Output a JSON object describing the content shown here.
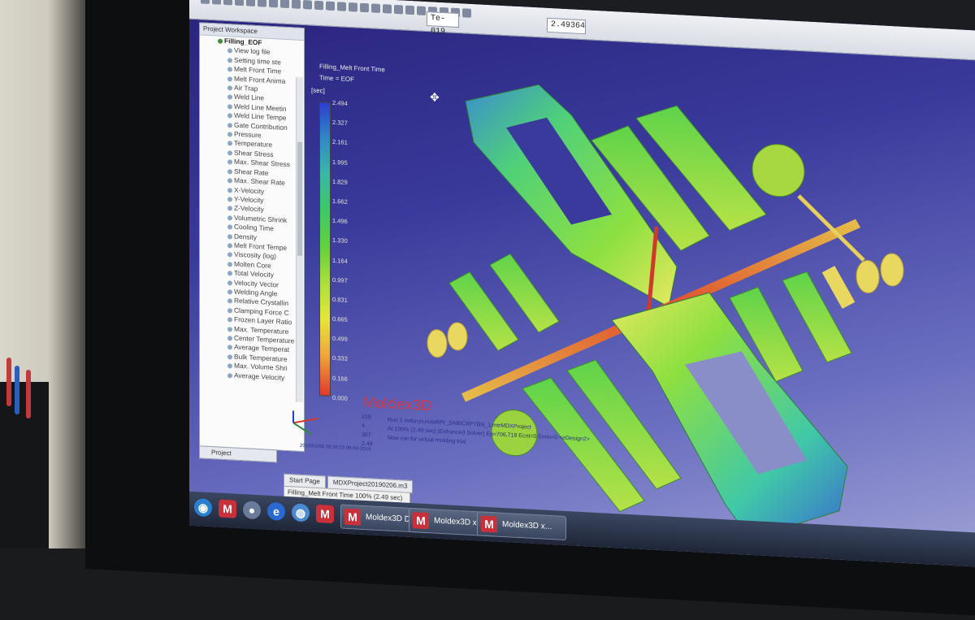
{
  "toolbar": {
    "field1": "Te-019",
    "field2": "2.49364"
  },
  "tree": {
    "header": "Project Workspace",
    "items": [
      {
        "label": "Filling_EOF",
        "root": true
      },
      {
        "label": "View log file"
      },
      {
        "label": "Setting time ste"
      },
      {
        "label": "Melt Front Time"
      },
      {
        "label": "Melt Front Anima"
      },
      {
        "label": "Air Trap"
      },
      {
        "label": "Weld Line"
      },
      {
        "label": "Weld Line Meetin"
      },
      {
        "label": "Weld Line Tempe"
      },
      {
        "label": "Gate Contribution"
      },
      {
        "label": "Pressure"
      },
      {
        "label": "Temperature"
      },
      {
        "label": "Shear Stress"
      },
      {
        "label": "Max. Shear Stress"
      },
      {
        "label": "Shear Rate"
      },
      {
        "label": "Max. Shear Rate"
      },
      {
        "label": "X-Velocity"
      },
      {
        "label": "Y-Velocity"
      },
      {
        "label": "Z-Velocity"
      },
      {
        "label": "Volumetric Shrink"
      },
      {
        "label": "Cooling Time"
      },
      {
        "label": "Density"
      },
      {
        "label": "Melt Front Tempe"
      },
      {
        "label": "Viscosity (log)"
      },
      {
        "label": "Molten Core"
      },
      {
        "label": "Total Velocity"
      },
      {
        "label": "Velocity Vector"
      },
      {
        "label": "Welding Angle"
      },
      {
        "label": "Relative Crystallin"
      },
      {
        "label": "Clamping Force C"
      },
      {
        "label": "Frozen Layer Ratio"
      },
      {
        "label": "Max. Temperature"
      },
      {
        "label": "Center Temperature"
      },
      {
        "label": "Average Temperat"
      },
      {
        "label": "Bulk Temperature"
      },
      {
        "label": "Max. Volume Shri"
      },
      {
        "label": "Average Velocity"
      }
    ],
    "project_tab": "Project"
  },
  "legend": {
    "title": "Filling_Melt Front Time",
    "time": "Time = EOF",
    "unit": "[sec]",
    "ticks": [
      "2.494",
      "2.327",
      "2.161",
      "1.995",
      "1.829",
      "1.662",
      "1.496",
      "1.330",
      "1.164",
      "0.997",
      "0.831",
      "0.665",
      "0.499",
      "0.333",
      "0.166",
      "0.000"
    ]
  },
  "logo": "Moldex3D",
  "info": {
    "nums": [
      "219",
      "4",
      "367",
      "2.49"
    ],
    "lines": [
      "Run 1 mdxrun.mdxRPr_SABICRP7BN_1.mtrMDXProject",
      "At 100% (2.49 sec) (Enhanced Solver) Ep=706,718 Ecnt=0 Emin=0 <eDesign2>",
      "Now run for virtual molding trial"
    ],
    "coords": "2019/02/06 09:20:23 06-04-2019"
  },
  "doc_tabs": [
    "Start Page",
    "MDXProject20190206.m3"
  ],
  "status": "Filling_Melt Front Time 100% (2.49 sec)",
  "taskbar": {
    "buttons": [
      "Moldex3D D...",
      "Moldex3D  x...",
      "Moldex3D  x..."
    ]
  },
  "colors": {
    "accent_red": "#d9363e",
    "screen_top": "#28227a",
    "screen_bottom": "#a6a8d8"
  }
}
